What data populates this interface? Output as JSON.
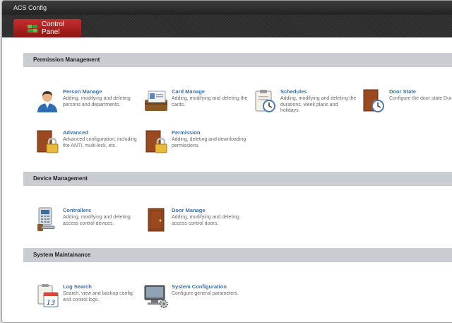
{
  "window": {
    "title": "ACS Config"
  },
  "tab": {
    "label": "Control Panel"
  },
  "sections": {
    "permission": {
      "title": "Permission Management",
      "items": [
        {
          "name": "Person Manage",
          "desc": "Adding, modifying and deleting persons and departments.",
          "icon": "person-icon"
        },
        {
          "name": "Card Manage",
          "desc": "Adding, modifying and deleting the cards.",
          "icon": "card-icon"
        },
        {
          "name": "Schedules",
          "desc": "Adding, modifying and deleting the durations, week plans and holidays.",
          "icon": "clipboard-clock-icon"
        },
        {
          "name": "Door State",
          "desc": "Configure the door state Durations.",
          "icon": "door-clock-icon"
        },
        {
          "name": "Advanced",
          "desc": "Advanced configuration, including the ANTI, multi-lock, etc.",
          "icon": "door-lock-icon"
        },
        {
          "name": "Permission",
          "desc": "Adding, deleting and downloading permissions.",
          "icon": "door-lock-icon"
        }
      ]
    },
    "device": {
      "title": "Device Management",
      "items": [
        {
          "name": "Controllers",
          "desc": "Adding, modifying and deleting access control devices.",
          "icon": "controller-icon"
        },
        {
          "name": "Door Manage",
          "desc": "Adding, modifying and deleting access control doors.",
          "icon": "door-icon"
        }
      ]
    },
    "system": {
      "title": "System Maintainance",
      "items": [
        {
          "name": "Log Search",
          "desc": "Search, view and backup config and control logs.",
          "icon": "calendar-log-icon"
        },
        {
          "name": "System Configuration",
          "desc": "Configure general parameters.",
          "icon": "computer-gear-icon"
        }
      ]
    }
  },
  "calendar_day": "13"
}
